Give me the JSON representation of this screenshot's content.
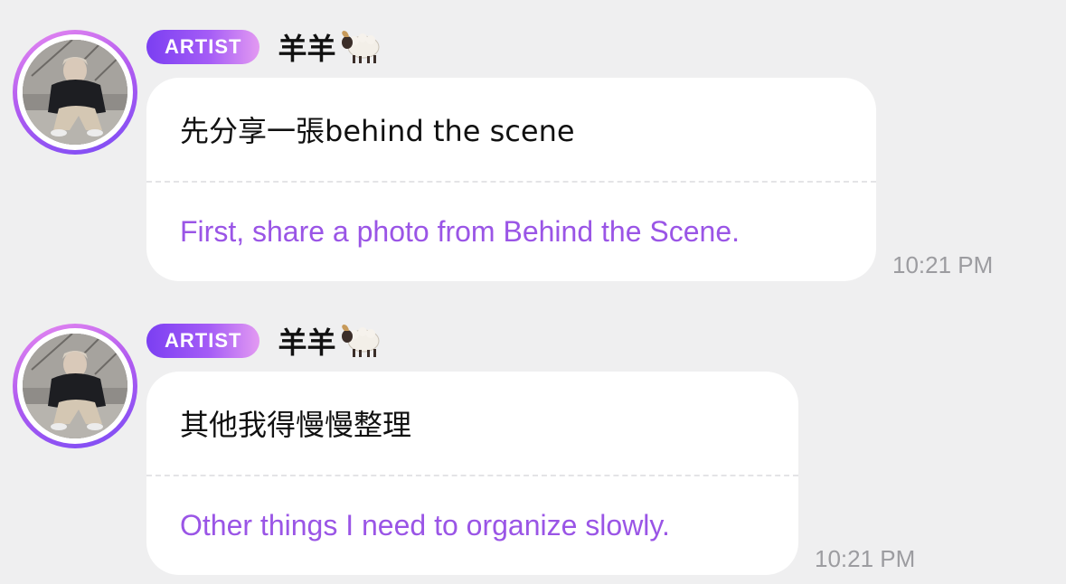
{
  "colors": {
    "background": "#efeff0",
    "bubble": "#ffffff",
    "translation_text": "#9a55e6",
    "badge_start": "#7b3ff2",
    "badge_end": "#e39af2",
    "timestamp": "#9c9ca0"
  },
  "messages": [
    {
      "badge": "ARTIST",
      "sender": "羊羊",
      "sender_emoji_icon": "sheep-icon",
      "original_text": "先分享一張behind the scene",
      "translation": "First, share a photo from Behind the Scene.",
      "time": "10:21 PM"
    },
    {
      "badge": "ARTIST",
      "sender": "羊羊",
      "sender_emoji_icon": "sheep-icon",
      "original_text": "其他我得慢慢整理",
      "translation": "Other things I need to organize slowly.",
      "time": "10:21 PM"
    }
  ]
}
